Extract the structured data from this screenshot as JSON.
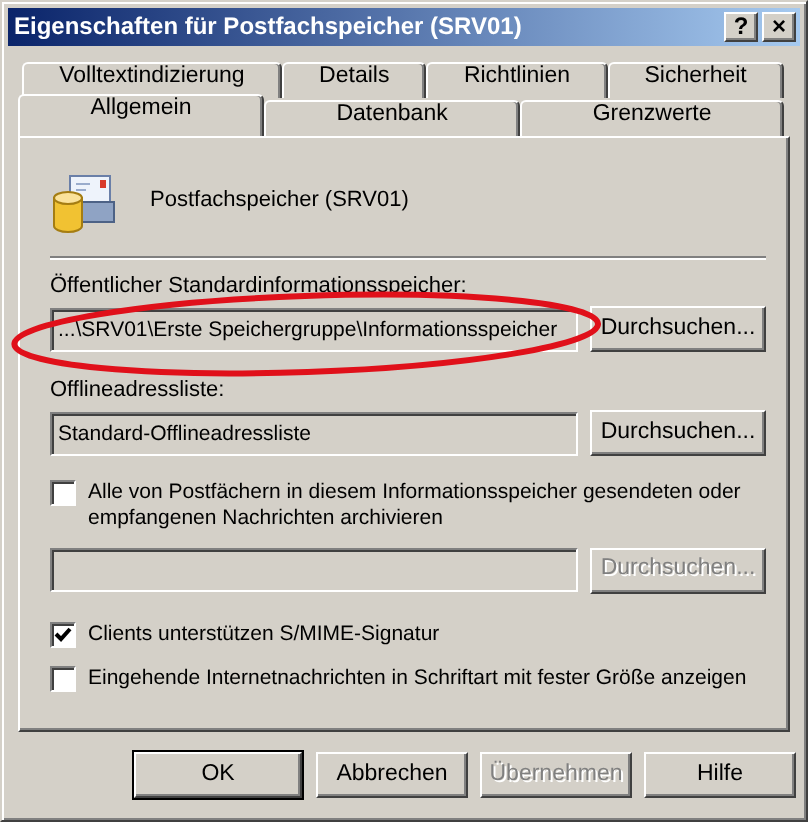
{
  "window": {
    "title": "Eigenschaften für Postfachspeicher (SRV01)",
    "title_buttons": [
      "?",
      "×"
    ]
  },
  "tab_rows": [
    [
      {
        "label": "Volltextindizierung",
        "selected": false
      },
      {
        "label": "Details",
        "selected": false
      },
      {
        "label": "Richtlinien",
        "selected": false
      },
      {
        "label": "Sicherheit",
        "selected": false
      }
    ],
    [
      {
        "label": "Allgemein",
        "selected": true
      },
      {
        "label": "Datenbank",
        "selected": false
      },
      {
        "label": "Grenzwerte",
        "selected": false
      }
    ]
  ],
  "header": {
    "name": "Postfachspeicher (SRV01)"
  },
  "public_store": {
    "label": "Öffentlicher Standardinformationsspeicher:",
    "value": "...\\SRV01\\Erste Speichergruppe\\Informationsspeicher",
    "button": "Durchsuchen...",
    "highlighted": true
  },
  "offline_list": {
    "label": "Offlineadressliste:",
    "value": "Standard-Offlineadressliste",
    "button": "Durchsuchen..."
  },
  "archive": {
    "label": "Alle von Postfächern in diesem Informationsspeicher gesendeten oder empfangenen Nachrichten archivieren",
    "checked": false,
    "button": "Durchsuchen...",
    "disabled": true
  },
  "options": [
    {
      "label": "Clients unterstützen S/MIME-Signatur",
      "checked": true
    },
    {
      "label": "Eingehende Internetnachrichten in Schriftart mit fester Größe anzeigen",
      "checked": false
    }
  ],
  "buttons": [
    {
      "label": "OK",
      "default": true,
      "disabled": false
    },
    {
      "label": "Abbrechen",
      "default": false,
      "disabled": false
    },
    {
      "label": "Übernehmen",
      "default": false,
      "disabled": true
    },
    {
      "label": "Hilfe",
      "default": false,
      "disabled": false
    }
  ]
}
